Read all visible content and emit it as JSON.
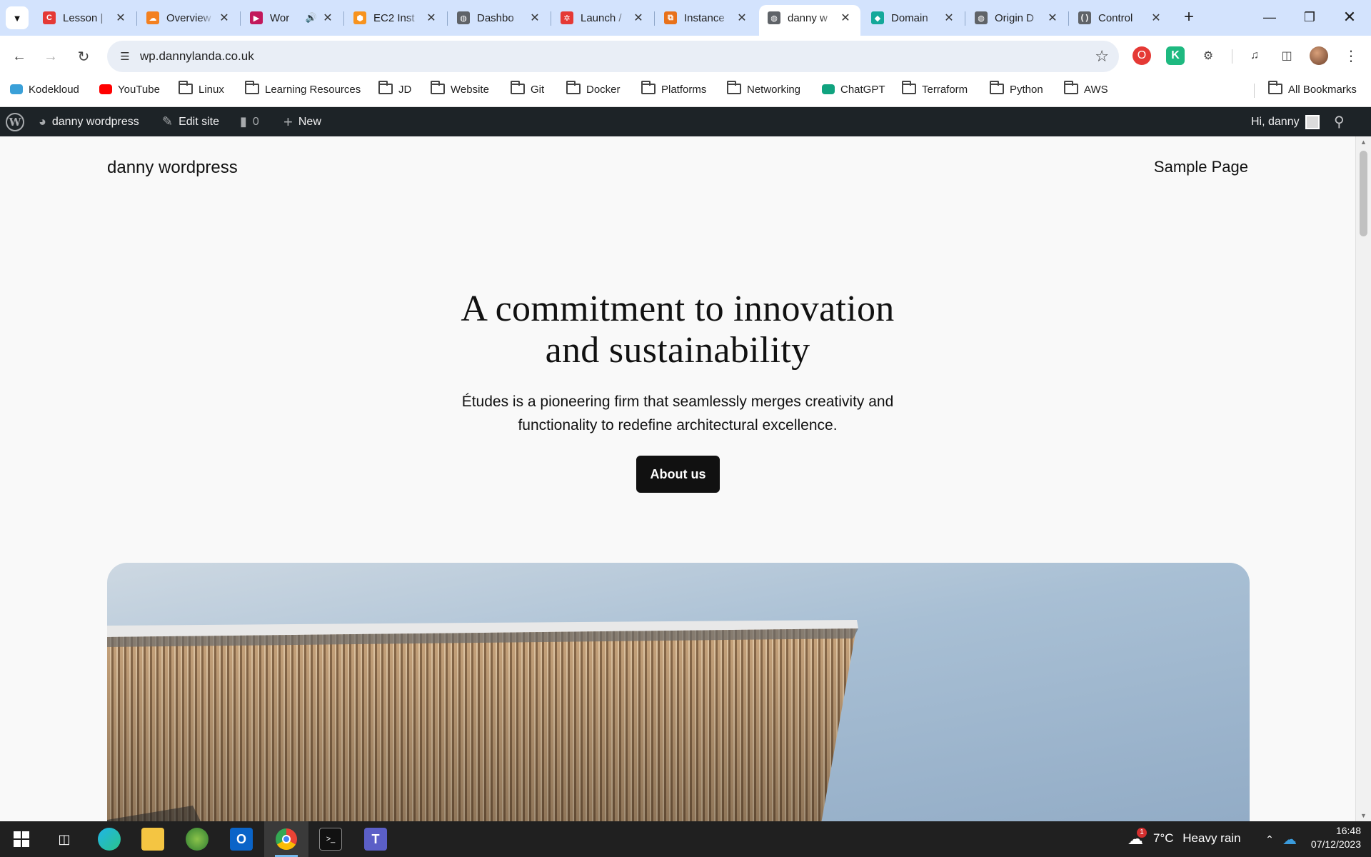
{
  "browser": {
    "tabs": [
      {
        "title": "Lesson |",
        "fav_color": "#e53935",
        "fav_glyph": "C",
        "icon": "lesson-icon"
      },
      {
        "title": "Overview",
        "fav_color": "#f38020",
        "fav_glyph": "☁",
        "icon": "cloudflare-icon"
      },
      {
        "title": "Wor",
        "fav_color": "#c2185b",
        "fav_glyph": "▶",
        "icon": "video-icon"
      },
      {
        "title": "EC2 Inst",
        "fav_color": "#f7931e",
        "fav_glyph": "⬢",
        "icon": "aws-icon"
      },
      {
        "title": "Dashbo",
        "fav_color": "#5f6368",
        "fav_glyph": "◍",
        "icon": "globe-icon"
      },
      {
        "title": "Launch /",
        "fav_color": "#e53935",
        "fav_glyph": "✲",
        "icon": "launch-icon"
      },
      {
        "title": "Instance",
        "fav_color": "#e8711a",
        "fav_glyph": "⧉",
        "icon": "instance-icon"
      },
      {
        "title": "danny w",
        "fav_color": "#5f6368",
        "fav_glyph": "◍",
        "icon": "globe-icon"
      },
      {
        "title": "Domain",
        "fav_color": "#14a89a",
        "fav_glyph": "◆",
        "icon": "domain-icon"
      },
      {
        "title": "Origin D",
        "fav_color": "#5f6368",
        "fav_glyph": "◍",
        "icon": "globe-icon"
      },
      {
        "title": "Control",
        "fav_color": "#5f6368",
        "fav_glyph": "( )",
        "icon": "control-icon"
      }
    ],
    "url": "wp.dannylanda.co.uk",
    "bookmarks": [
      {
        "label": "Kodekloud",
        "type": "site",
        "color": "#3aa0d8"
      },
      {
        "label": "YouTube",
        "type": "site",
        "color": "#ff0000"
      },
      {
        "label": "Linux",
        "type": "folder"
      },
      {
        "label": "Learning Resources",
        "type": "folder"
      },
      {
        "label": "JD",
        "type": "folder"
      },
      {
        "label": "Website",
        "type": "folder"
      },
      {
        "label": "Git",
        "type": "folder"
      },
      {
        "label": "Docker",
        "type": "folder"
      },
      {
        "label": "Platforms",
        "type": "folder"
      },
      {
        "label": "Networking",
        "type": "folder"
      },
      {
        "label": "ChatGPT",
        "type": "site",
        "color": "#10a37f"
      },
      {
        "label": "Terraform",
        "type": "folder"
      },
      {
        "label": "Python",
        "type": "folder"
      },
      {
        "label": "AWS",
        "type": "folder"
      }
    ],
    "all_bookmarks": "All Bookmarks"
  },
  "adminbar": {
    "site_name": "danny wordpress",
    "edit_site": "Edit site",
    "comments_count": "0",
    "new_label": "New",
    "greeting": "Hi, danny"
  },
  "site": {
    "title": "danny wordpress",
    "nav_item": "Sample Page",
    "hero_title_line1": "A commitment to innovation",
    "hero_title_line2": "and sustainability",
    "hero_sub_line1": "Études is a pioneering firm that seamlessly merges creativity and",
    "hero_sub_line2": "functionality to redefine architectural excellence.",
    "hero_button": "About us"
  },
  "taskbar": {
    "weather_temp": "7°C",
    "weather_desc": "Heavy rain",
    "weather_badge": "1",
    "time": "16:48",
    "date": "07/12/2023"
  },
  "colors": {
    "tabstrip": "#d3e3fd",
    "adminbar": "#1d2327",
    "button": "#111111",
    "taskbar": "#202020"
  }
}
